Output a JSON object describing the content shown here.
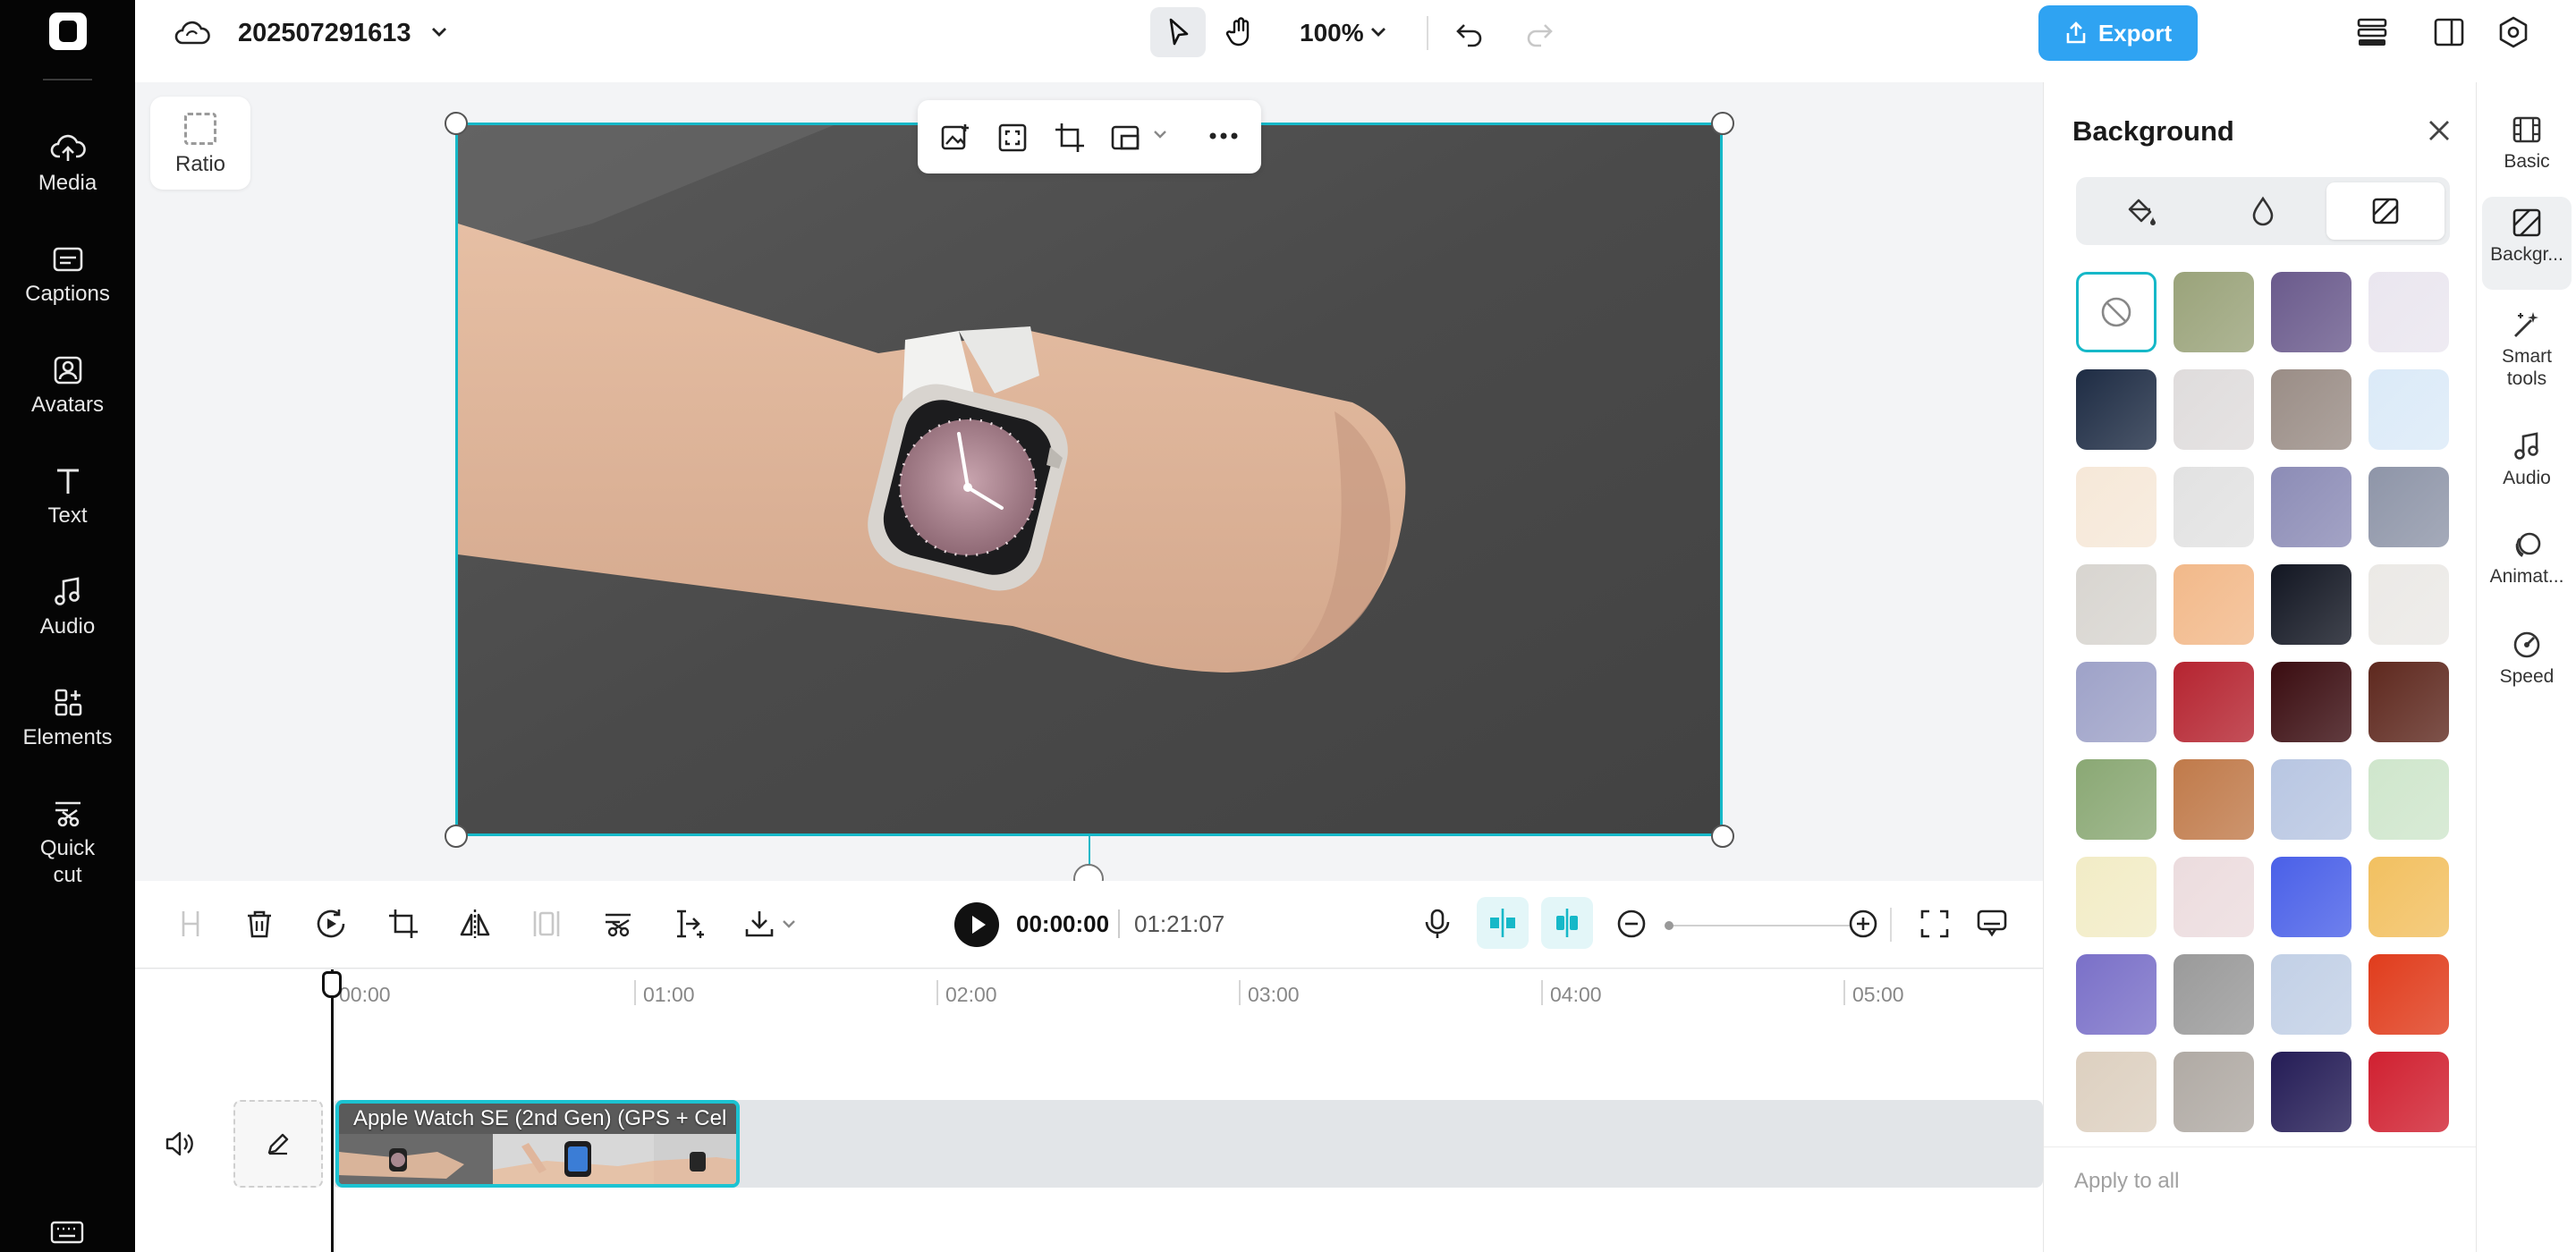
{
  "left_sidebar": {
    "items": [
      {
        "label": "Media"
      },
      {
        "label": "Captions"
      },
      {
        "label": "Avatars"
      },
      {
        "label": "Text"
      },
      {
        "label": "Audio"
      },
      {
        "label": "Elements"
      },
      {
        "label": "Quick\ncut"
      }
    ]
  },
  "topbar": {
    "project_name": "202507291613",
    "zoom": "100%",
    "export_label": "Export"
  },
  "canvas": {
    "ratio_label": "Ratio"
  },
  "player": {
    "current_time": "00:00:00",
    "total_time": "01:21:07"
  },
  "timeline": {
    "ruler": [
      "00:00",
      "01:00",
      "02:00",
      "03:00",
      "04:00",
      "05:00"
    ],
    "clip_title": "Apple Watch SE (2nd Gen) (GPS + Cel"
  },
  "background_panel": {
    "title": "Background",
    "apply_all": "Apply to all",
    "swatches": [
      "#ffffff",
      "#9aa37a",
      "#6a5a8c",
      "#eae6ef",
      "#1e2c44",
      "#dfdcdc",
      "#9a8d86",
      "#dbeaf8",
      "#f6e8d8",
      "#e2e2e2",
      "#8c8cb6",
      "#8e95a8",
      "#d8d5d0",
      "#f2b98a",
      "#121622",
      "#ebe9e6",
      "#9ea2c8",
      "#b52430",
      "#3a0c10",
      "#5e281e",
      "#8aa874",
      "#c07a4a",
      "#b8c6e2",
      "#cfe6cc",
      "#f2ecc6",
      "#ecdcde",
      "#4a60e8",
      "#f2c060",
      "#7a70c8",
      "#9a9a9a",
      "#c2d0e6",
      "#e03c1c",
      "#ddd0c0",
      "#b0aaa4",
      "#241c56",
      "#d02030"
    ]
  },
  "right_rail": {
    "items": [
      {
        "label": "Basic"
      },
      {
        "label": "Backgr..."
      },
      {
        "label": "Smart\ntools"
      },
      {
        "label": "Audio"
      },
      {
        "label": "Animat..."
      },
      {
        "label": "Speed"
      }
    ]
  }
}
